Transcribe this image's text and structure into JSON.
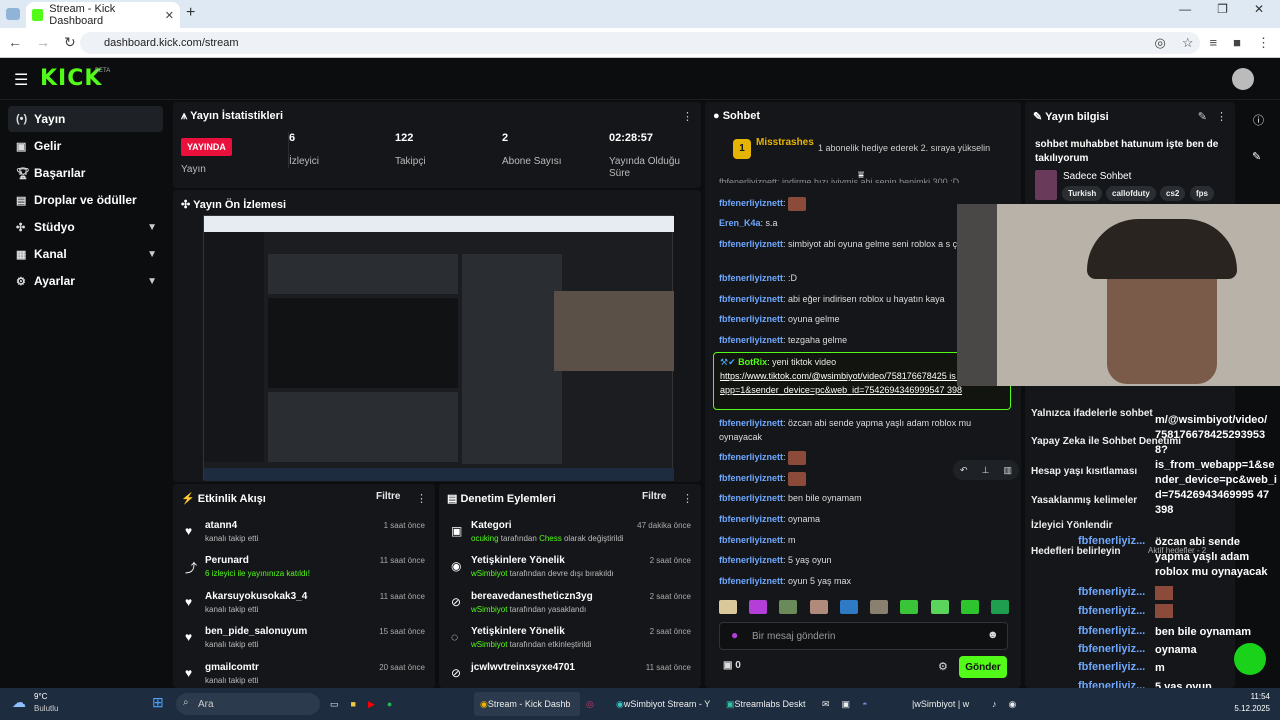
{
  "browser": {
    "tab_title": "Stream - Kick Dashboard",
    "url": "dashboard.kick.com/stream"
  },
  "sidebar": {
    "items": [
      {
        "label": "Yayın",
        "icon": "broadcast-icon"
      },
      {
        "label": "Gelir",
        "icon": "revenue-icon"
      },
      {
        "label": "Başarılar",
        "icon": "trophy-icon"
      },
      {
        "label": "Droplar ve ödüller",
        "icon": "gift-icon"
      },
      {
        "label": "Stüdyo",
        "icon": "studio-icon"
      },
      {
        "label": "Kanal",
        "icon": "channel-icon"
      },
      {
        "label": "Ayarlar",
        "icon": "gear-icon"
      }
    ]
  },
  "stats": {
    "title": "Yayın İstatistikleri",
    "live_badge": "YAYINDA",
    "live_label": "Yayın",
    "viewers_value": "6",
    "viewers_label": "İzleyici",
    "followers_value": "122",
    "followers_label": "Takipçi",
    "subs_value": "2",
    "subs_label": "Abone Sayısı",
    "duration_value": "02:28:57",
    "duration_label": "Yayında Olduğu Süre"
  },
  "preview": {
    "title": "Yayın Ön İzlemesi"
  },
  "activity": {
    "title": "Etkinlik Akışı",
    "filter": "Filtre",
    "items": [
      {
        "name": "atann4",
        "sub": "kanalı takip etti",
        "time": "1 saat önce"
      },
      {
        "name": "Perunard",
        "sub": "6 izleyici ile yayınınıza katıldı!",
        "time": "11 saat önce"
      },
      {
        "name": "Akarsuyokusokak3_4",
        "sub": "kanalı takip etti",
        "time": "11 saat önce"
      },
      {
        "name": "ben_pide_salonuyum",
        "sub": "kanalı takip etti",
        "time": "15 saat önce"
      },
      {
        "name": "gmailcomtr",
        "sub": "kanalı takip etti",
        "time": "20 saat önce"
      }
    ]
  },
  "moderation": {
    "title": "Denetim Eylemleri",
    "filter": "Filtre",
    "items": [
      {
        "name": "Kategori",
        "actor": "ocuking",
        "mid": " tarafından ",
        "hl": "Chess",
        "tail": " olarak değiştirildi",
        "time": "47 dakika önce"
      },
      {
        "name": "Yetişkinlere Yönelik",
        "actor": "wSimbiyot",
        "mid": " tarafından devre dışı bırakıldı",
        "hl": "",
        "tail": "",
        "time": "2 saat önce"
      },
      {
        "name": "bereavedanestheticzn3yg",
        "actor": "wSimbiyot",
        "mid": " tarafından yasaklandı",
        "hl": "",
        "tail": "",
        "time": "2 saat önce"
      },
      {
        "name": "Yetişkinlere Yönelik",
        "actor": "wSimbiyot",
        "mid": " tarafından etkinleştirildi",
        "hl": "",
        "tail": "",
        "time": "2 saat önce"
      },
      {
        "name": "jcwlwvtreinxsyxe4701",
        "actor": "",
        "mid": "",
        "hl": "",
        "tail": "",
        "time": "11 saat önce"
      }
    ]
  },
  "chat": {
    "title": "Sohbet",
    "pinned_user": "Misstrashes",
    "pinned_badge": "1",
    "pinned_note": "1 abonelik hediye ederek 2. sıraya yükselin",
    "cut_line": "fbfenerliyiznett: indirme hızı iyiymiş abi senin benimki 300 :D",
    "messages": [
      {
        "user": "fbfenerliyiznett",
        "text": ""
      },
      {
        "user": "Eren_K4a",
        "text": "s.a"
      },
      {
        "user": "fbfenerliyiznett",
        "text": "simbiyot abi oyuna gelme seni roblox a s çalışıyo"
      },
      {
        "user": "fbfenerliyiznett",
        "text": ":D"
      },
      {
        "user": "fbfenerliyiznett",
        "text": "abi eğer indirisen roblox u hayatın kaya"
      },
      {
        "user": "fbfenerliyiznett",
        "text": "oyuna gelme"
      },
      {
        "user": "fbfenerliyiznett",
        "text": "tezgaha gelme"
      }
    ],
    "bot_user": "BotRix",
    "bot_text": "yeni tiktok video",
    "bot_link": "https://www.tiktok.com/@wsimbiyot/video/758176678425 is_from_webapp=1&sender_device=pc&web_id=7542694346999547 398",
    "messages2": [
      {
        "user": "fbfenerliyiznett",
        "text": "özcan abi sende yapma yaşlı adam roblox mu oynayacak"
      },
      {
        "user": "fbfenerliyiznett",
        "text": ""
      },
      {
        "user": "fbfenerliyiznett",
        "text": ""
      },
      {
        "user": "fbfenerliyiznett",
        "text": "ben bile oynamam"
      },
      {
        "user": "fbfenerliyiznett",
        "text": "oynama"
      },
      {
        "user": "fbfenerliyiznett",
        "text": "m"
      },
      {
        "user": "fbfenerliyiznett",
        "text": "5 yaş oyun"
      },
      {
        "user": "fbfenerliyiznett",
        "text": "oyun 5 yaş max"
      }
    ],
    "input_placeholder": "Bir mesaj gönderin",
    "points": "0",
    "send": "Gönder"
  },
  "info": {
    "title": "Yayın bilgisi",
    "stream_title": "sohbet muhabbet hatunum işte ben de takılıyorum",
    "category": "Sadece Sohbet",
    "tags": [
      "Turkish",
      "callofduty",
      "cs2",
      "fps"
    ],
    "settings": [
      "Yalnızca ifadelerle sohbet",
      "Yapay Zeka ile Sohbet Denetimi",
      "Hesap yaşı kısıtlaması",
      "Yasaklanmış kelimeler",
      "İzleyici Yönlendir",
      "Hedefleri belirleyin"
    ],
    "goals_note": "Aktif hedefler - 2"
  },
  "overlay": {
    "link_lines": [
      "m/@wsimbiyot/video/",
      "758176678425293953",
      "8?",
      "is_from_webapp=1&se",
      "nder_device=pc&web_i",
      "d=75426943469995 47",
      "398"
    ],
    "msg_lines": [
      "özcan abi sende",
      "yapma yaşlı adam",
      "roblox mu oynayacak"
    ],
    "user": "fbfenerliyiz...",
    "msgs": [
      "ben bile oynamam",
      "oynama",
      "m",
      "5 yaş oyun",
      "oyun 5 yaş max"
    ]
  },
  "taskbar": {
    "weather_temp": "9°C",
    "weather_desc": "Bulutlu",
    "search_placeholder": "Ara",
    "apps": [
      "Stream - Kick Dashb",
      "wSimbiyot Stream - Y",
      "Streamlabs Deskt",
      "|wSimbiyot | w"
    ],
    "time": "11:54",
    "date": "5.12.2025"
  }
}
